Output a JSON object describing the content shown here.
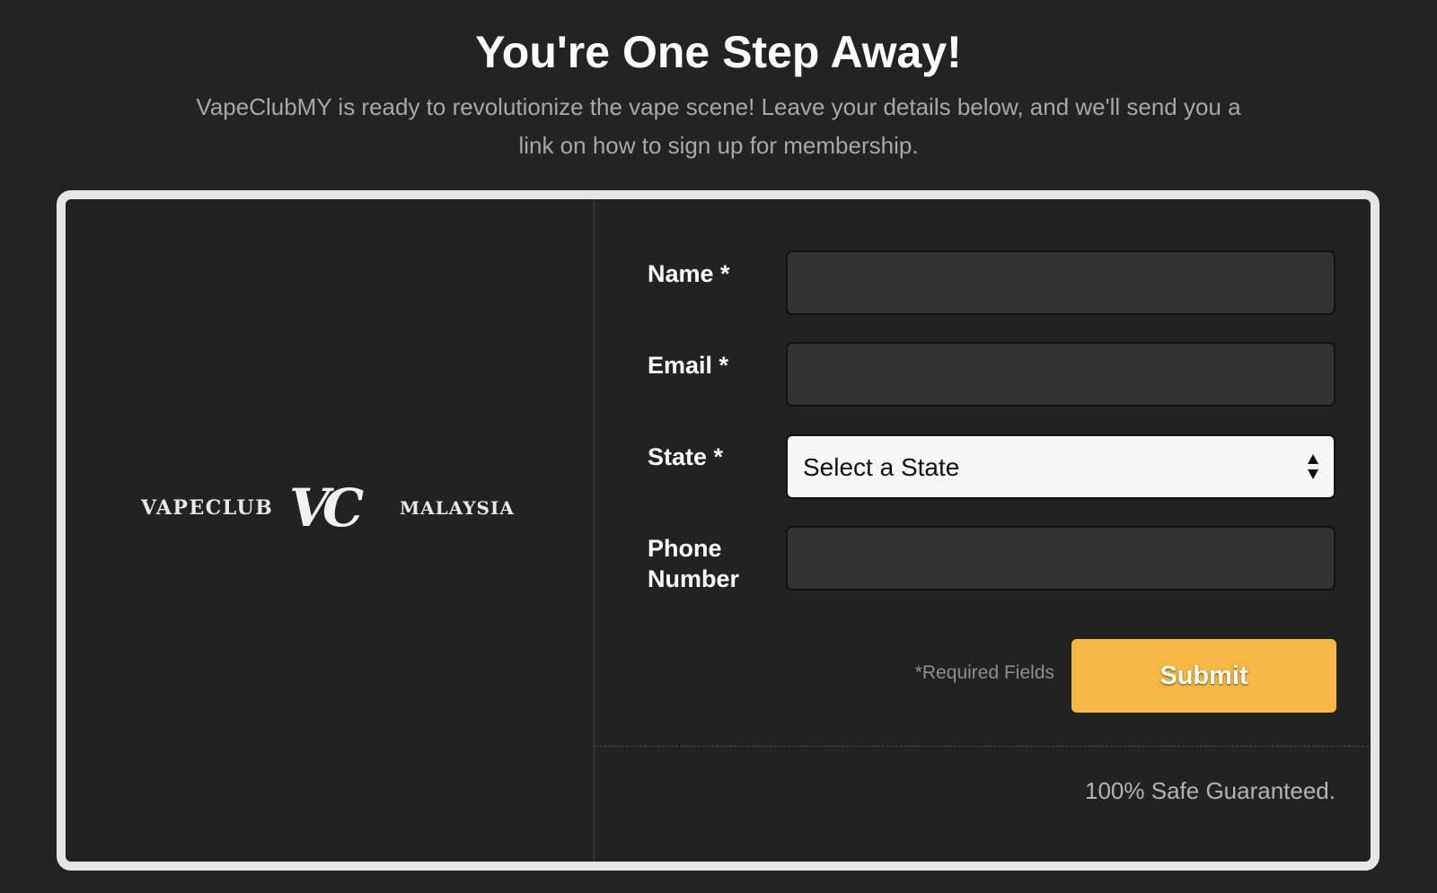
{
  "page": {
    "headline": "You're One Step Away!",
    "subheadline": "VapeClubMY is ready to revolutionize the vape scene! Leave your details below, and we'll send you a link on how to sign up for membership."
  },
  "logo": {
    "left_text": "VAPECLUB",
    "monogram": "VC",
    "right_text": "MALAYSIA"
  },
  "form": {
    "name": {
      "label": "Name *",
      "value": "",
      "placeholder": ""
    },
    "email": {
      "label": "Email *",
      "value": "",
      "placeholder": ""
    },
    "state": {
      "label": "State *",
      "selected": "Select a State"
    },
    "phone": {
      "label_line1": "Phone",
      "label_line2": "Number",
      "value": "",
      "placeholder": ""
    },
    "required_note": "*Required Fields",
    "submit_label": "Submit"
  },
  "footer": {
    "safe_text": "100% Safe Guaranteed."
  },
  "colors": {
    "background": "#232323",
    "card_border": "#e5e5e5",
    "submit_button": "#f5b843",
    "input_background": "#323232",
    "select_background": "#f7f7f7"
  },
  "icons": {
    "select_arrows": "up-down-caret-icon"
  }
}
